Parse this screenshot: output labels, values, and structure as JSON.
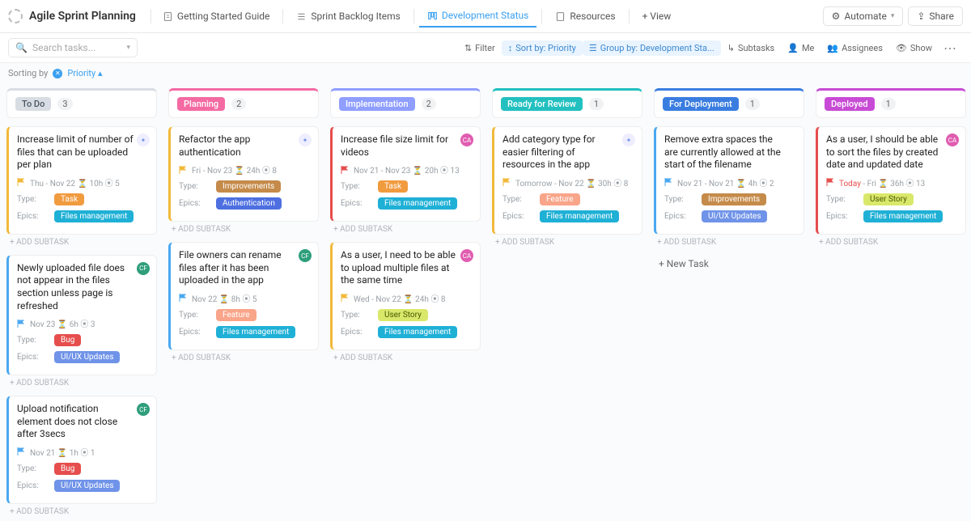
{
  "header": {
    "title": "Agile Sprint Planning",
    "tabs": [
      {
        "label": "Getting Started Guide"
      },
      {
        "label": "Sprint Backlog Items"
      },
      {
        "label": "Development Status"
      },
      {
        "label": "Resources"
      }
    ],
    "addView": "+ View",
    "automate": "Automate",
    "share": "Share"
  },
  "toolbar": {
    "searchPlaceholder": "Search tasks...",
    "filter": "Filter",
    "sort": "Sort by: Priority",
    "group": "Group by: Development Sta...",
    "subtasks": "Subtasks",
    "me": "Me",
    "assignees": "Assignees",
    "show": "Show"
  },
  "sorting": {
    "prefix": "Sorting by",
    "label": "Priority",
    "caret": "▴"
  },
  "columns": [
    {
      "name": "To Do",
      "pillBg": "#d8dde3",
      "pillColor": "#4a5560",
      "count": 3,
      "topColor": "#d8dde3"
    },
    {
      "name": "Planning",
      "pillBg": "#f46aa3",
      "pillColor": "#fff",
      "count": 2,
      "topColor": "#f46aa3"
    },
    {
      "name": "Implementation",
      "pillBg": "#8f9eff",
      "pillColor": "#fff",
      "count": 2,
      "topColor": "#8f9eff"
    },
    {
      "name": "Ready for Review",
      "pillBg": "#22c0bf",
      "pillColor": "#fff",
      "count": 1,
      "topColor": "#22c0bf"
    },
    {
      "name": "For Deployment",
      "pillBg": "#3a7de0",
      "pillColor": "#fff",
      "count": 1,
      "topColor": "#3a7de0"
    },
    {
      "name": "Deployed",
      "pillBg": "#c84bd6",
      "pillColor": "#fff",
      "count": 1,
      "topColor": "#c84bd6"
    }
  ],
  "tagColors": {
    "Task": "#f19b3f",
    "Bug": "#e64d4d",
    "User Story": "#d9e86b",
    "Feature": "#f9a58a",
    "Improvements": "#c58b4a",
    "Files management": "#1fb0d6",
    "UI/UX Updates": "#6f93e8",
    "Authentication": "#4d6fe0"
  },
  "cards": {
    "todo": [
      {
        "title": "Increase limit of number of files that can be uploaded per plan",
        "avatar": {
          "bg": "#eef",
          "txt": "✦",
          "color": "#6f93e8"
        },
        "flag": "#f1b93a",
        "meta": "Thu  -  Nov 22  ⏳ 10h  ⦿ 5",
        "border": "#f1b93a",
        "type": "Task",
        "epic": "Files management"
      },
      {
        "title": "Newly uploaded file does not appear in the files section unless page is refreshed",
        "avatar": {
          "bg": "#2e9e7b",
          "txt": "CF",
          "color": "#fff"
        },
        "flag": "#4aa8f0",
        "meta": "Nov 23  ⏳ 6h  ⦿ 3",
        "border": "#4aa8f0",
        "type": "Bug",
        "epic": "UI/UX Updates"
      },
      {
        "title": "Upload notification element does not close after 3secs",
        "avatar": {
          "bg": "#2e9e7b",
          "txt": "CF",
          "color": "#fff"
        },
        "flag": "#4aa8f0",
        "meta": "Nov 21  ⏳ 1h  ⦿ 1",
        "border": "#4aa8f0",
        "type": "Bug",
        "epic": "UI/UX Updates"
      }
    ],
    "planning": [
      {
        "title": "Refactor the app authentication",
        "avatar": {
          "bg": "#eef",
          "txt": "✦",
          "color": "#6f93e8"
        },
        "flag": "#f1b93a",
        "meta": "Fri  -  Nov 23  ⏳ 24h  ⦿ 8",
        "border": "#f1b93a",
        "type": "Improvements",
        "epic": "Authentication"
      },
      {
        "title": "File owners can rename files after it has been uploaded in the app",
        "avatar": {
          "bg": "#2e9e7b",
          "txt": "CF",
          "color": "#fff"
        },
        "flag": "#4aa8f0",
        "meta": "Nov 22  ⏳ 8h  ⦿ 5",
        "border": "#4aa8f0",
        "type": "Feature",
        "epic": "Files management"
      }
    ],
    "impl": [
      {
        "title": "Increase file size limit for videos",
        "avatar": {
          "bg": "#e05db0",
          "txt": "CA",
          "color": "#fff"
        },
        "flag": "#e64d4d",
        "meta": "Nov 21  -  Nov 23  ⏳ 20h  ⦿ 13",
        "border": "#e64d4d",
        "type": "Task",
        "epic": "Files management"
      },
      {
        "title": "As a user, I need to be able to upload multiple files at the same time",
        "avatar": {
          "bg": "#e05db0",
          "txt": "CA",
          "color": "#fff"
        },
        "flag": "#f1b93a",
        "meta": "Wed  -  Nov 22  ⏳ 24h  ⦿ 8",
        "border": "#f1b93a",
        "type": "User Story",
        "epic": "Files management"
      }
    ],
    "review": [
      {
        "title": "Add category type for easier filtering of resources in the app",
        "avatar": {
          "bg": "#eef",
          "txt": "✦",
          "color": "#6f93e8"
        },
        "flag": "#f1b93a",
        "meta": "Tomorrow  -  Nov 22  ⏳ 30h  ⦿ 8",
        "border": "#f1b93a",
        "type": "Feature",
        "epic": "Files management"
      }
    ],
    "deploy": [
      {
        "title": "Remove extra spaces the are currently allowed at the start of the filename",
        "avatar": null,
        "flag": "#4aa8f0",
        "meta": "Nov 21  -  Nov 21  ⏳ 4h  ⦿ 2",
        "border": "#4aa8f0",
        "type": "Improvements",
        "epic": "UI/UX Updates"
      }
    ],
    "deployed": [
      {
        "title": "As a user, I should be able to sort the files by created date and updated date",
        "avatar": {
          "bg": "#e05db0",
          "txt": "CA",
          "color": "#fff"
        },
        "flag": "#e64d4d",
        "meta": "Today  -  Fri  ⏳ 36h  ⦿ 13",
        "border": "#e64d4d",
        "type": "User Story",
        "epic": "Files management",
        "today": true
      }
    ]
  },
  "labels": {
    "type": "Type:",
    "epics": "Epics:",
    "addsub": "+ ADD SUBTASK",
    "newtask": "+ New Task"
  }
}
